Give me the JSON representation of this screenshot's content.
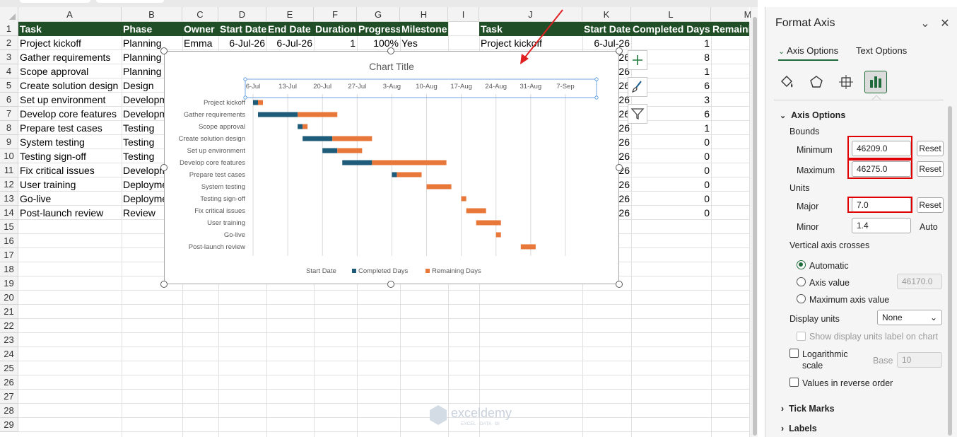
{
  "columns": [
    "A",
    "B",
    "C",
    "D",
    "E",
    "F",
    "G",
    "H",
    "I",
    "J",
    "K",
    "L",
    "M"
  ],
  "rows": [
    "1",
    "2",
    "3",
    "4",
    "5",
    "6",
    "7",
    "8",
    "9",
    "10",
    "11",
    "12",
    "13",
    "14",
    "15",
    "16",
    "17",
    "18",
    "19",
    "20",
    "21",
    "22",
    "23",
    "24",
    "25",
    "26",
    "27",
    "28",
    "29"
  ],
  "table1": {
    "headers": [
      "Task",
      "Phase",
      "Owner",
      "Start Date",
      "End Date",
      "Duration",
      "Progress",
      "Milestone"
    ],
    "row2": {
      "task": "Project kickoff",
      "phase": "Planning",
      "owner": "Emma",
      "start": "6-Jul-26",
      "end": "6-Jul-26",
      "duration": "1",
      "progress": "100%",
      "milestone": "Yes"
    },
    "tasks": [
      "Gather requirements",
      "Scope approval",
      "Create solution design",
      "Set up environment",
      "Develop core features",
      "Prepare test cases",
      "System testing",
      "Testing sign-off",
      "Fix critical issues",
      "User training",
      "Go-live",
      "Post-launch review"
    ],
    "phases": [
      "Planning",
      "Planning",
      "Design",
      "Developm",
      "Developm",
      "Testing",
      "Testing",
      "Testing",
      "Developm",
      "Deployme",
      "Deployme",
      "Review"
    ]
  },
  "table2": {
    "headers": [
      "Task",
      "Start Date",
      "Completed Days",
      "Remaini"
    ],
    "row2": {
      "task": "Project kickoff",
      "start": "6-Jul-26"
    },
    "start_fragments": [
      "26",
      "26",
      "26",
      "26",
      "26",
      "26",
      "26",
      "26",
      "26",
      "26",
      "26",
      "26"
    ],
    "completed": [
      "1",
      "8",
      "1",
      "6",
      "3",
      "6",
      "1",
      "0",
      "0",
      "0",
      "0",
      "0",
      "0"
    ]
  },
  "chart_data": {
    "type": "bar",
    "orientation": "horizontal-stacked",
    "title": "Chart Title",
    "x_ticks": [
      "6-Jul",
      "13-Jul",
      "20-Jul",
      "27-Jul",
      "3-Aug",
      "10-Aug",
      "17-Aug",
      "24-Aug",
      "31-Aug",
      "7-Sep"
    ],
    "xlim": [
      46209,
      46275
    ],
    "x_major": 7,
    "categories": [
      "Project kickoff",
      "Gather requirements",
      "Scope approval",
      "Create solution design",
      "Set up environment",
      "Develop core features",
      "Prepare test cases",
      "System testing",
      "Testing sign-off",
      "Fix critical issues",
      "User training",
      "Go-live",
      "Post-launch review"
    ],
    "series": [
      {
        "name": "Start Date",
        "values": [
          46209,
          46210,
          46218,
          46219,
          46223,
          46227,
          46237,
          46244,
          46251,
          46252,
          46254,
          46258,
          46263
        ],
        "color": "none"
      },
      {
        "name": "Completed Days",
        "values": [
          1,
          8,
          1,
          6,
          3,
          6,
          1,
          0,
          0,
          0,
          0,
          0,
          0
        ],
        "color": "#1f5c7a"
      },
      {
        "name": "Remaining Days",
        "values": [
          1,
          8,
          1,
          8,
          5,
          15,
          5,
          5,
          1,
          4,
          5,
          1,
          3
        ],
        "color": "#e8773a"
      }
    ],
    "grid": true,
    "legend": "bottom"
  },
  "pane": {
    "title": "Format Axis",
    "tab_axis": "Axis Options",
    "tab_text": "Text Options",
    "section": "Axis Options",
    "bounds": "Bounds",
    "minimum_label": "Minimum",
    "minimum_value": "46209.0",
    "maximum_label": "Maximum",
    "maximum_value": "46275.0",
    "reset": "Reset",
    "units": "Units",
    "major_label": "Major",
    "major_value": "7.0",
    "minor_label": "Minor",
    "minor_value": "1.4",
    "auto": "Auto",
    "vertical_crosses": "Vertical axis crosses",
    "automatic": "Automatic",
    "axis_value": "Axis value",
    "axis_value_input": "46170.0",
    "max_axis_value": "Maximum axis value",
    "display_units": "Display units",
    "display_units_value": "None",
    "show_units_label": "Show display units label on chart",
    "logarithmic": "Logarithmic",
    "scale": "scale",
    "base": "Base",
    "base_value": "10",
    "reverse": "Values in reverse order",
    "tick_marks": "Tick Marks",
    "labels": "Labels"
  },
  "watermark": {
    "brand": "exceldemy",
    "tagline": "EXCEL · DATA · BI"
  },
  "colors": {
    "header_green": "#1f4e27",
    "completed": "#1f5c7a",
    "remaining": "#e8773a",
    "highlight_red": "#e00000"
  }
}
